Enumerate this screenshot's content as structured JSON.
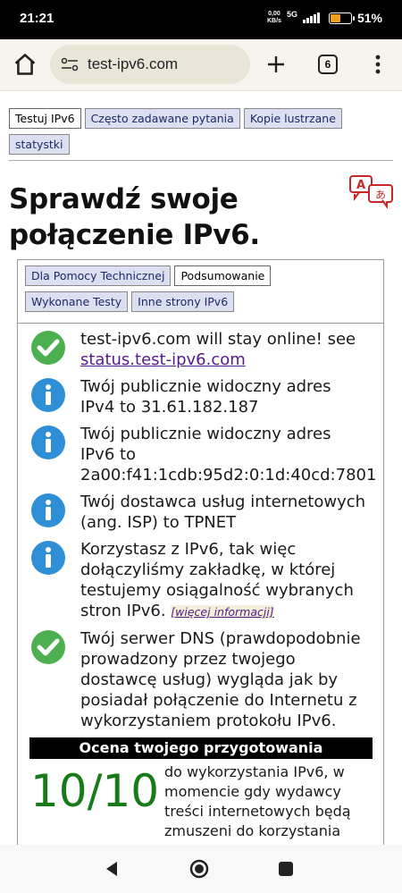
{
  "status_bar": {
    "time": "21:21",
    "speed_value": "0,00",
    "speed_unit": "KB/s",
    "network": "5G",
    "battery_percent": "51%",
    "battery_level": 0.51
  },
  "browser": {
    "url": "test-ipv6.com",
    "tab_count": "6"
  },
  "top_nav": [
    {
      "label": "Testuj IPv6",
      "active": true
    },
    {
      "label": "Często zadawane pytania",
      "active": false
    },
    {
      "label": "Kopie lustrzane",
      "active": false
    },
    {
      "label": "statystki",
      "active": false
    }
  ],
  "page": {
    "title_line1": "Sprawdź swoje",
    "title_line2": "połączenie IPv6."
  },
  "sub_nav": [
    {
      "label": "Dla Pomocy Technicznej",
      "active": false
    },
    {
      "label": "Podsumowanie",
      "active": true
    },
    {
      "label": "Wykonane Testy",
      "active": false
    },
    {
      "label": "Inne strony IPv6",
      "active": false
    }
  ],
  "results": [
    {
      "icon": "check-icon",
      "text": "test-ipv6.com will stay online! see ",
      "link": "status.test-ipv6.com"
    },
    {
      "icon": "info-icon",
      "text": "Twój publicznie widoczny adres IPv4 to 31.61.182.187"
    },
    {
      "icon": "info-icon",
      "text": "Twój publicznie widoczny adres IPv6 to 2a00:f41:1cdb:95d2:0:1d:40cd:7801"
    },
    {
      "icon": "info-icon",
      "text": "Twój dostawca usług internetowych (ang. ISP) to TPNET"
    },
    {
      "icon": "info-icon",
      "text": "Korzystasz z IPv6, tak więc dołączyliśmy zakładkę, w której testujemy osiągalność wybranych stron IPv6. ",
      "more": "[więcej informacji]"
    },
    {
      "icon": "check-icon",
      "text": "Twój serwer DNS (prawdopodobnie prowadzony przez twojego dostawcę usług) wygląda jak by posiadał połączenie do Internetu z wykorzystaniem protokołu IPv6."
    }
  ],
  "readiness": {
    "heading": "Ocena twojego przygotowania",
    "score": "10/10",
    "description": "do wykorzystania IPv6, w momencie gdy wydawcy treści internetowych będą zmuszeni do korzystania"
  },
  "colors": {
    "check": "#4caf50",
    "info": "#2e8fd6",
    "score": "#1a7a1a",
    "link": "#551a8b"
  }
}
